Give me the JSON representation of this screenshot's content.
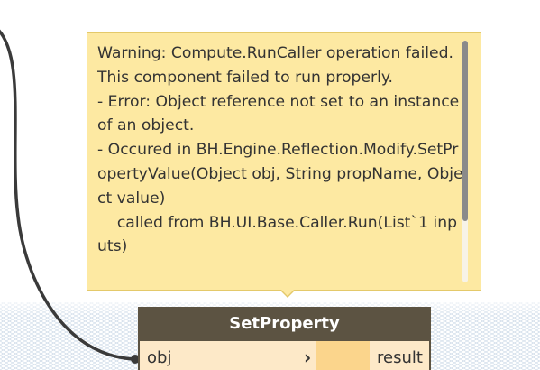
{
  "colors": {
    "canvas_background": "#ffffff",
    "grid_line": "#c9d7e6",
    "wire": "#3a3a3a",
    "tooltip_background": "#fde9a2",
    "tooltip_border": "#e4c96a",
    "node_header": "#5c5342",
    "node_body": "#fde9c8",
    "port_swatch": "#fbd58c"
  },
  "tooltip": {
    "message": "Warning: Compute.RunCaller operation failed.\nThis component failed to run properly.\n- Error: Object reference not set to an instance of an object.\n- Occured in BH.Engine.Reflection.Modify.SetPropertyValue(Object obj, String propName, Object value)\n    called from BH.UI.Base.Caller.Run(List`1 inputs)",
    "scroll_position": 0.0
  },
  "node": {
    "title": "SetProperty",
    "input_label": "obj",
    "output_label": "result",
    "chevron_icon": "chevron-right-icon"
  }
}
